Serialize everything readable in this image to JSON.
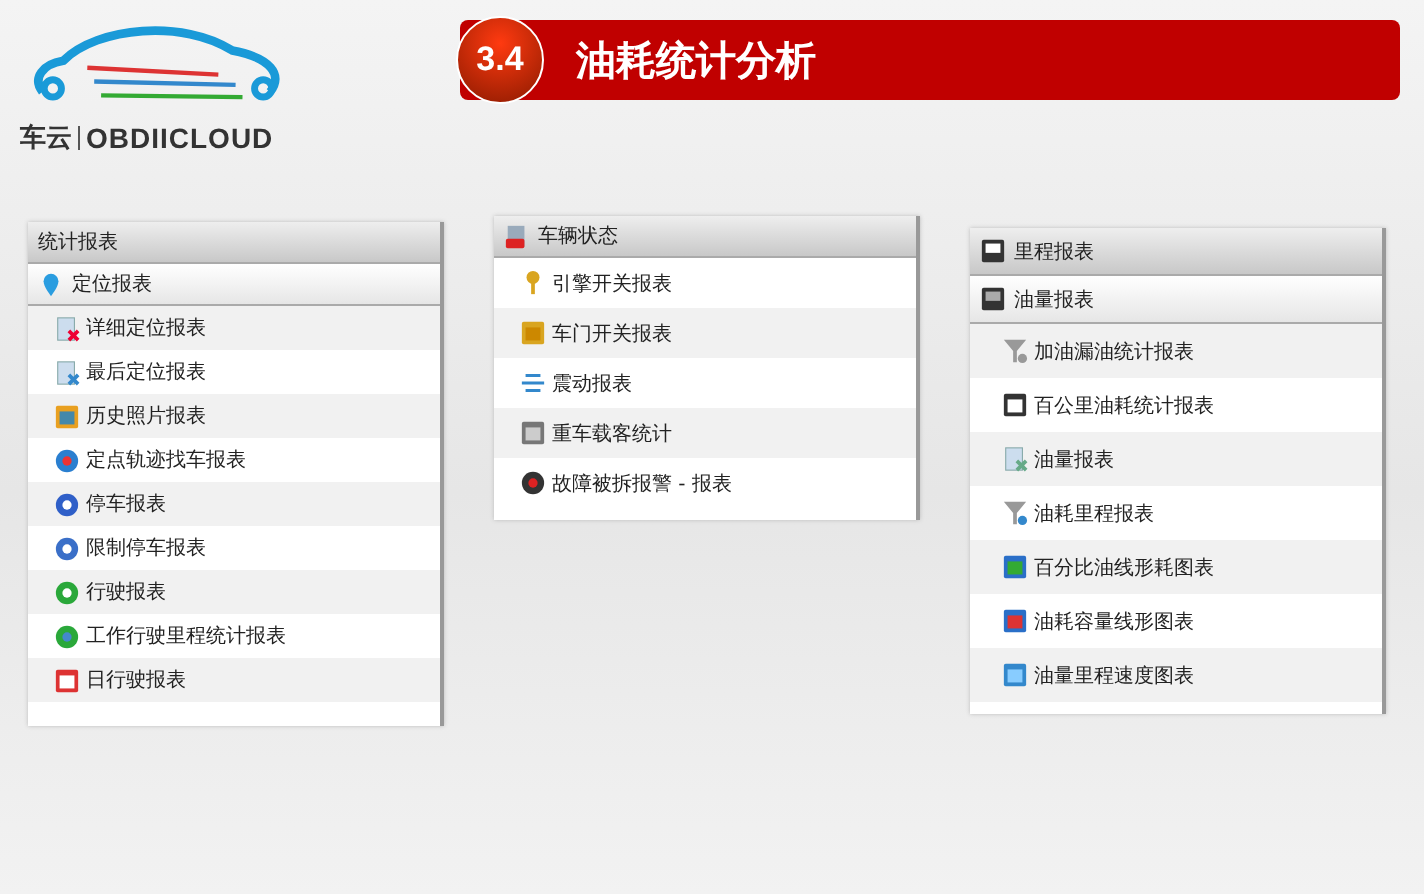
{
  "logo": {
    "cn": "车云",
    "en": "OBDIICLOUD"
  },
  "title": {
    "number": "3.4",
    "text": "油耗统计分析"
  },
  "panels": [
    {
      "headers": [
        "统计报表",
        "定位报表"
      ],
      "items": [
        "详细定位报表",
        "最后定位报表",
        "历史照片报表",
        "定点轨迹找车报表",
        "停车报表",
        "限制停车报表",
        "行驶报表",
        "工作行驶里程统计报表",
        "日行驶报表"
      ]
    },
    {
      "headers": [
        "车辆状态"
      ],
      "items": [
        "引擎开关报表",
        "车门开关报表",
        "震动报表",
        "重车载客统计",
        "故障被拆报警 - 报表"
      ]
    },
    {
      "headers": [
        "里程报表",
        "油量报表"
      ],
      "items": [
        "加油漏油统计报表",
        "百公里油耗统计报表",
        "油量报表",
        "油耗里程报表",
        "百分比油线形耗图表",
        "油耗容量线形图表",
        "油量里程速度图表"
      ]
    }
  ]
}
